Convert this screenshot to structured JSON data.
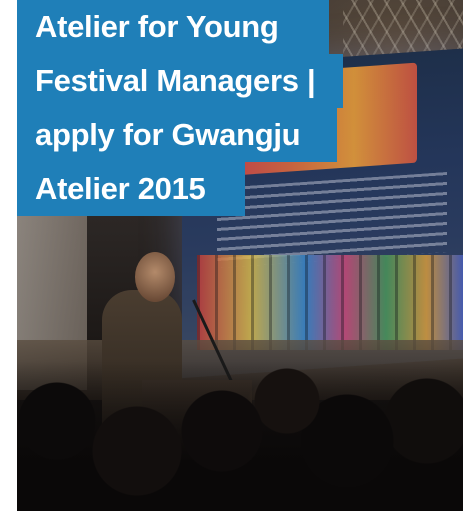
{
  "card": {
    "title_lines": [
      "Atelier for Young",
      "Festival Managers |",
      "apply for Gwangju",
      "Atelier 2015"
    ]
  },
  "colors": {
    "title_background": "#1f7fb8",
    "title_text": "#ffffff"
  }
}
